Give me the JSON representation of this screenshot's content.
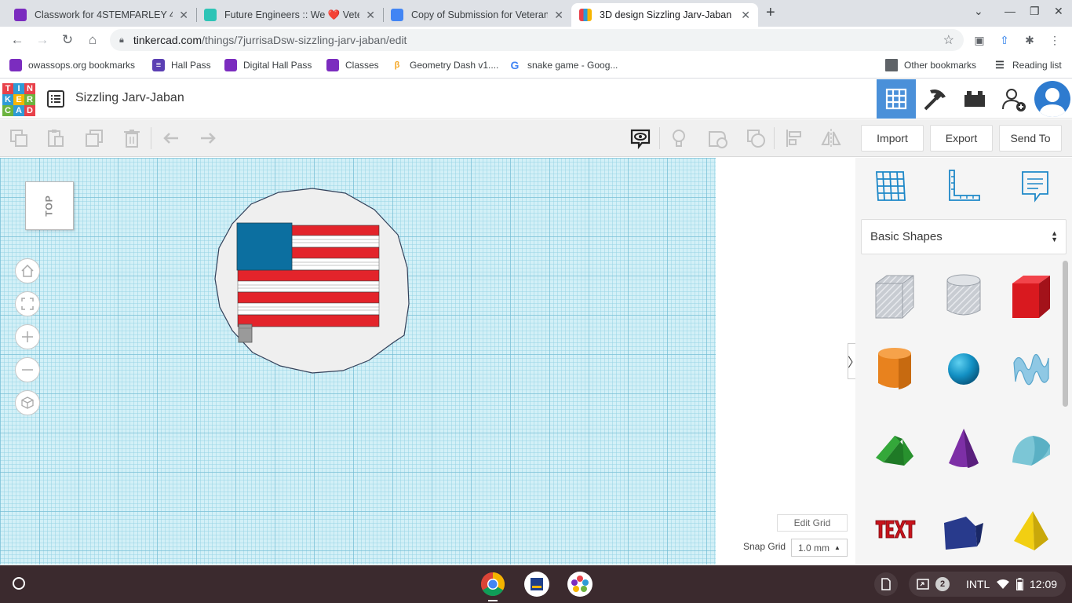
{
  "browser": {
    "tabs": [
      {
        "title": "Classwork for 4STEMFARLEY 4",
        "favicon_color": "#7b2cbf"
      },
      {
        "title": "Future Engineers :: We ❤️ Vetera",
        "favicon_color": "#2ec4b6"
      },
      {
        "title": "Copy of Submission for Veteran",
        "favicon_color": "#4285f4"
      },
      {
        "title": "3D design Sizzling Jarv-Jaban |",
        "favicon_color": "#e8414a"
      }
    ],
    "url_host": "tinkercad.com",
    "url_path": "/things/7jurrisaDsw-sizzling-jarv-jaban/edit",
    "bookmarks": [
      {
        "label": "owassops.org bookmarks",
        "color": "#7b2cbf"
      },
      {
        "label": "Hall Pass",
        "color": "#5b3fb3"
      },
      {
        "label": "Digital Hall Pass",
        "color": "#7b2cbf"
      },
      {
        "label": "Classes",
        "color": "#7b2cbf"
      },
      {
        "label": "Geometry Dash v1....",
        "color": "#f5a623"
      },
      {
        "label": "snake game - Goog...",
        "color": "#4285f4"
      }
    ],
    "other_bookmarks": "Other bookmarks",
    "reading_list": "Reading list"
  },
  "app": {
    "logo_letters": [
      "T",
      "I",
      "N",
      "K",
      "E",
      "R",
      "C",
      "A",
      "D"
    ],
    "design_title": "Sizzling Jarv-Jaban"
  },
  "toolbar": {
    "import_label": "Import",
    "export_label": "Export",
    "send_to_label": "Send To"
  },
  "workplane": {
    "viewcube_label": "TOP",
    "edit_grid_label": "Edit Grid",
    "snap_grid_label": "Snap Grid",
    "snap_grid_value": "1.0 mm"
  },
  "panel": {
    "category_selected": "Basic Shapes",
    "shapes": [
      "box-hole-icon",
      "cylinder-hole-icon",
      "box-icon",
      "cylinder-icon",
      "sphere-icon",
      "scribble-icon",
      "roof-icon",
      "cone-icon",
      "round-roof-icon",
      "text-icon",
      "polygon-icon",
      "pyramid-icon"
    ]
  },
  "shelf": {
    "notification_count": "2",
    "keyboard_layout": "INTL",
    "clock": "12:09"
  },
  "colors": {
    "tinkercad_blue": "#4a90d9",
    "flag_red": "#e3242b",
    "flag_blue": "#0c6fa0"
  }
}
